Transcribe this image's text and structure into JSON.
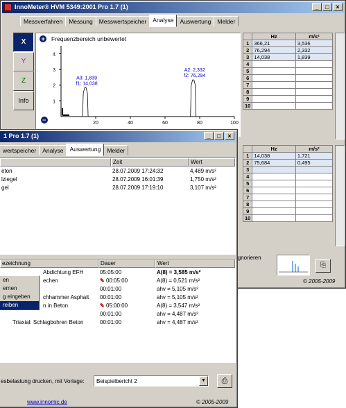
{
  "main_window": {
    "title": "InnoMeter® HVM 5349:2001 Pro 1.7 (1)",
    "tabs": [
      "Messverfahren",
      "Messung",
      "Messwertspeicher",
      "Analyse",
      "Auswertung",
      "Melder"
    ],
    "active_tab": "Analyse",
    "side_buttons": [
      "X",
      "Y",
      "Z",
      "Info"
    ],
    "chart_title": "Frequenzbereich unbewertet",
    "footer": "© 2005-2009",
    "ignore_label": "ignorieren"
  },
  "chart_data": {
    "type": "line",
    "title": "Frequenzbereich unbewertet",
    "xlim": [
      0,
      100
    ],
    "ylim": [
      0,
      4.5
    ],
    "xticks": [
      "20",
      "40",
      "60",
      "80",
      "100"
    ],
    "yticks": [
      "1",
      "2",
      "3",
      "4"
    ],
    "peaks": [
      {
        "x": 14.038,
        "y": 1.839
      },
      {
        "x": 76.294,
        "y": 2.332
      }
    ],
    "annotations": [
      {
        "line1": "A3: 1,839",
        "line2": "f1: 14,038"
      },
      {
        "line1": "A2: 2,332",
        "line2": "f2: 76,294"
      }
    ]
  },
  "table_top": {
    "headers": [
      "Hz",
      "m/s²"
    ],
    "rows": [
      {
        "n": "1",
        "hz": "366,21",
        "v": "3,536"
      },
      {
        "n": "2",
        "hz": "76,294",
        "v": "2,332"
      },
      {
        "n": "3",
        "hz": "14,038",
        "v": "1,839"
      },
      {
        "n": "4",
        "hz": "",
        "v": ""
      },
      {
        "n": "5",
        "hz": "",
        "v": ""
      },
      {
        "n": "6",
        "hz": "",
        "v": ""
      },
      {
        "n": "7",
        "hz": "",
        "v": ""
      },
      {
        "n": "8",
        "hz": "",
        "v": ""
      },
      {
        "n": "9",
        "hz": "",
        "v": ""
      },
      {
        "n": "10",
        "hz": "",
        "v": ""
      }
    ]
  },
  "table_bottom": {
    "headers": [
      "Hz",
      "m/s²"
    ],
    "rows": [
      {
        "n": "1",
        "hz": "14,038",
        "v": "1,721"
      },
      {
        "n": "2",
        "hz": "75,684",
        "v": "0,495"
      },
      {
        "n": "3",
        "hz": "",
        "v": ""
      },
      {
        "n": "4",
        "hz": "",
        "v": ""
      },
      {
        "n": "5",
        "hz": "",
        "v": ""
      },
      {
        "n": "6",
        "hz": "",
        "v": ""
      },
      {
        "n": "7",
        "hz": "",
        "v": ""
      },
      {
        "n": "8",
        "hz": "",
        "v": ""
      },
      {
        "n": "9",
        "hz": "",
        "v": ""
      },
      {
        "n": "10",
        "hz": "",
        "v": ""
      }
    ]
  },
  "second_window": {
    "title": "1 Pro 1.7 (1)",
    "tabs": [
      "wertspeicher",
      "Analyse",
      "Auswertung",
      "Melder"
    ],
    "active_tab": "Auswertung",
    "list1_headers": [
      "",
      "Zeit",
      "Wert"
    ],
    "list1_rows": [
      {
        "name": "eton",
        "time": "28.07.2009 17:24:32",
        "value": "4,489 m/s²"
      },
      {
        "name": "lziegel",
        "time": "28.07.2009 16:01:39",
        "value": "1,750 m/s²"
      },
      {
        "name": "gel",
        "time": "28.07.2009 17:19:10",
        "value": "3,107 m/s²"
      }
    ],
    "list2_headers": [
      "ezeichnung",
      "Dauer",
      "Wert"
    ],
    "list2_rows": [
      {
        "name": "Abdichtung EFH",
        "dur": "05:05:00",
        "val": "A(8) = 3,585 m/s²"
      },
      {
        "name": "echen",
        "dur": "00:05:00",
        "val": "A(8) = 0,521 m/s²"
      },
      {
        "name": "",
        "dur": "00:01:00",
        "val": "ahv = 5,105 m/s²"
      },
      {
        "name": "chhammer Asphalt",
        "dur": "00:01:00",
        "val": "ahv = 5,105 m/s²"
      },
      {
        "name": "n in Beton",
        "dur": "05:00:00",
        "val": "A(8) = 3,547 m/s²"
      },
      {
        "name": "",
        "dur": "00:01:00",
        "val": "ahv = 4,487 m/s²"
      },
      {
        "name": "Triaxial: Schlagbohren Beton",
        "dur": "00:01:00",
        "val": "ahv = 4,487 m/s²"
      }
    ],
    "context_menu": [
      "en",
      "ernen",
      "g eingeben",
      "reiben"
    ],
    "print_label": "esbelastung drucken, mit Vorlage:",
    "template_value": "Beispielbericht 2",
    "url": "www.innomic.de",
    "footer": "© 2005-2009"
  }
}
